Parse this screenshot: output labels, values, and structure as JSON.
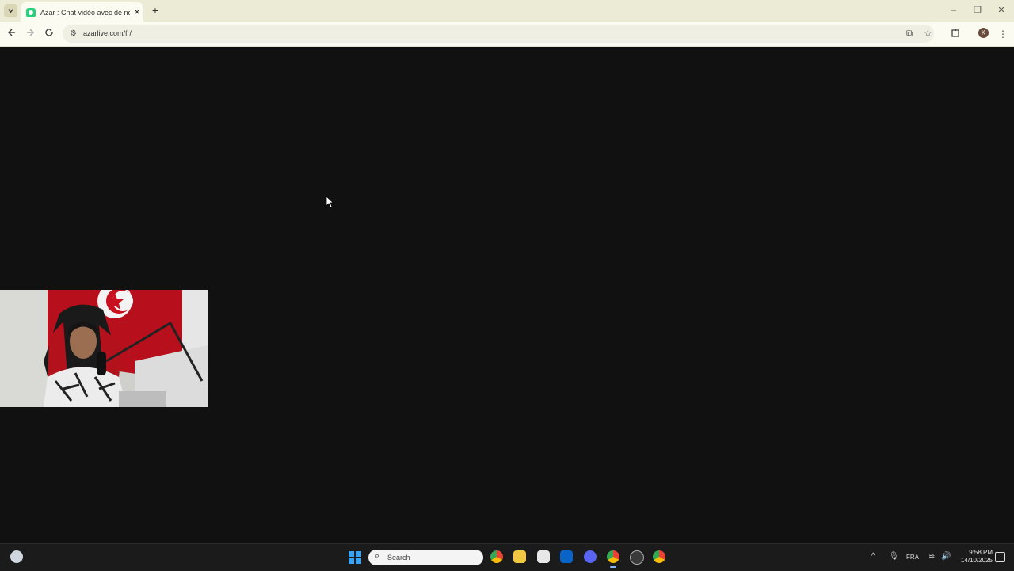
{
  "browser": {
    "tab_title": "Azar : Chat vidéo avec de nouv",
    "url": "azarlive.com/fr/",
    "profile_initial": "K"
  },
  "taskbar": {
    "search_placeholder": "Search",
    "language": "FRA",
    "time": "9:58 PM",
    "date": "14/10/2025"
  },
  "icons": [
    "tab-search-icon",
    "close-icon",
    "plus-icon",
    "back-icon",
    "forward-icon",
    "reload-icon",
    "site-info-icon",
    "install-app-icon",
    "star-icon",
    "extensions-icon",
    "menu-dots-icon",
    "windows-start-icon",
    "search-icon",
    "chrome-icon",
    "folder-icon",
    "store-icon",
    "outlook-icon",
    "discord-icon",
    "steam-icon",
    "chevron-up-icon",
    "microphone-icon",
    "wifi-icon",
    "volume-icon",
    "notification-icon"
  ],
  "colors": {
    "accent": "#27d07b",
    "titlebar": "#ecebd5",
    "page_bg": "#111112"
  }
}
